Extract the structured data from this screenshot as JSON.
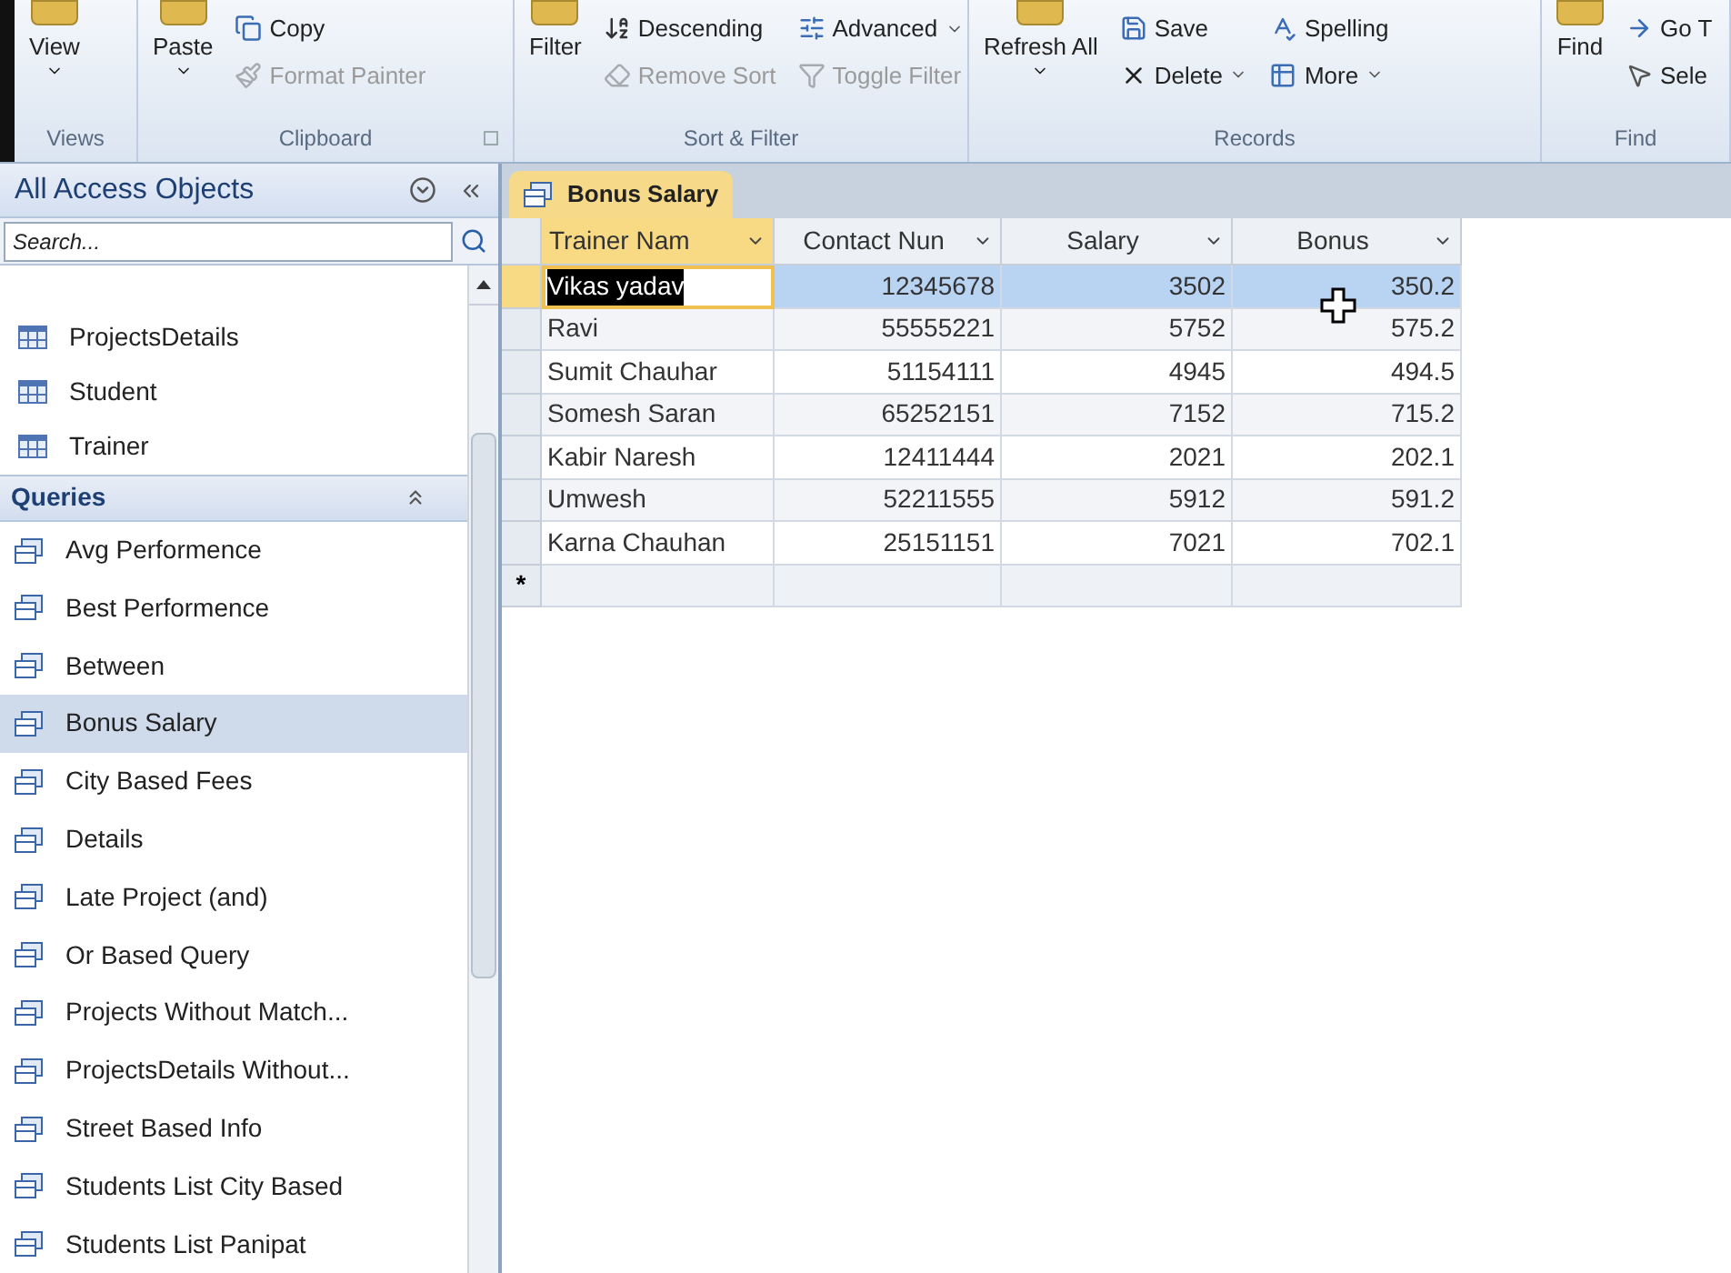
{
  "ribbon": {
    "groups": [
      {
        "label": "Views",
        "launcher": false,
        "large_button": {
          "label": "View",
          "dropdown": true,
          "disabled": false
        }
      },
      {
        "label": "Clipboard",
        "launcher": true,
        "large_button": {
          "label": "Paste",
          "dropdown": true,
          "disabled": false
        },
        "small_buttons": [
          {
            "label": "Copy",
            "dropdown": false,
            "disabled": false
          },
          {
            "label": "Format Painter",
            "dropdown": false,
            "disabled": true
          }
        ]
      },
      {
        "label": "Sort & Filter",
        "launcher": false,
        "large_button": {
          "label": "Filter",
          "dropdown": false,
          "disabled": false
        },
        "small_buttons": [
          {
            "label": "Descending",
            "dropdown": false,
            "disabled": false
          },
          {
            "label": "Remove Sort",
            "dropdown": false,
            "disabled": true
          },
          {
            "label": "Advanced",
            "dropdown": true,
            "disabled": false
          },
          {
            "label": "Toggle Filter",
            "dropdown": false,
            "disabled": true
          }
        ]
      },
      {
        "label": "Records",
        "launcher": false,
        "large_button": {
          "label": "Refresh All",
          "dropdown": true,
          "disabled": false
        },
        "small_buttons": [
          {
            "label": "Save",
            "dropdown": false,
            "disabled": false
          },
          {
            "label": "Delete",
            "dropdown": true,
            "disabled": false
          },
          {
            "label": "Spelling",
            "dropdown": false,
            "disabled": false
          },
          {
            "label": "More",
            "dropdown": true,
            "disabled": false
          }
        ]
      },
      {
        "label": "Find",
        "launcher": false,
        "large_button": {
          "label": "Find",
          "dropdown": false,
          "disabled": false
        },
        "small_buttons": [
          {
            "label": "Go T",
            "dropdown": false,
            "disabled": false
          },
          {
            "label": "Sele",
            "dropdown": false,
            "disabled": false
          }
        ]
      }
    ]
  },
  "nav": {
    "title": "All Access Objects",
    "search": {
      "placeholder": "Search..."
    },
    "table_items": [
      {
        "label": "ProjectsDetails",
        "selected": false
      },
      {
        "label": "Student",
        "selected": false
      },
      {
        "label": "Trainer",
        "selected": false
      }
    ],
    "queries": {
      "title": "Queries",
      "expanded": true,
      "items": [
        {
          "label": "Avg Performence",
          "selected": false
        },
        {
          "label": "Best Performence",
          "selected": false
        },
        {
          "label": "Between",
          "selected": false
        },
        {
          "label": "Bonus Salary",
          "selected": true
        },
        {
          "label": "City Based Fees",
          "selected": false
        },
        {
          "label": "Details",
          "selected": false
        },
        {
          "label": "Late Project (and)",
          "selected": false
        },
        {
          "label": "Or Based Query",
          "selected": false
        },
        {
          "label": "Projects Without Match...",
          "selected": false
        },
        {
          "label": "ProjectsDetails Without...",
          "selected": false
        },
        {
          "label": "Street Based Info",
          "selected": false
        },
        {
          "label": "Students List City Based",
          "selected": false
        },
        {
          "label": "Students List Panipat",
          "selected": false
        }
      ]
    }
  },
  "document_tab": {
    "label": "Bonus Salary",
    "selected": true
  },
  "table": {
    "columns": [
      {
        "label": "Trainer Nam",
        "active": true
      },
      {
        "label": "Contact Nun",
        "active": false
      },
      {
        "label": "Salary",
        "active": false
      },
      {
        "label": "Bonus",
        "active": false
      }
    ],
    "rows": [
      {
        "cells": [
          "Vikas yadav",
          "12345678",
          "3502",
          "350.2"
        ],
        "selected": true,
        "text_highlighted": true
      },
      {
        "cells": [
          "Ravi",
          "55555221",
          "5752",
          "575.2"
        ],
        "selected": false,
        "text_highlighted": false
      },
      {
        "cells": [
          "Sumit Chauhar",
          "51154111",
          "4945",
          "494.5"
        ],
        "selected": false,
        "text_highlighted": false
      },
      {
        "cells": [
          "Somesh Saran",
          "65252151",
          "7152",
          "715.2"
        ],
        "selected": false,
        "text_highlighted": false
      },
      {
        "cells": [
          "Kabir Naresh",
          "12411444",
          "2021",
          "202.1"
        ],
        "selected": false,
        "text_highlighted": false
      },
      {
        "cells": [
          "Umwesh",
          "52211555",
          "5912",
          "591.2"
        ],
        "selected": false,
        "text_highlighted": false
      },
      {
        "cells": [
          "Karna Chauhan",
          "25151151",
          "7021",
          "702.1"
        ],
        "selected": false,
        "text_highlighted": false
      }
    ],
    "new_row_marker": "*"
  }
}
